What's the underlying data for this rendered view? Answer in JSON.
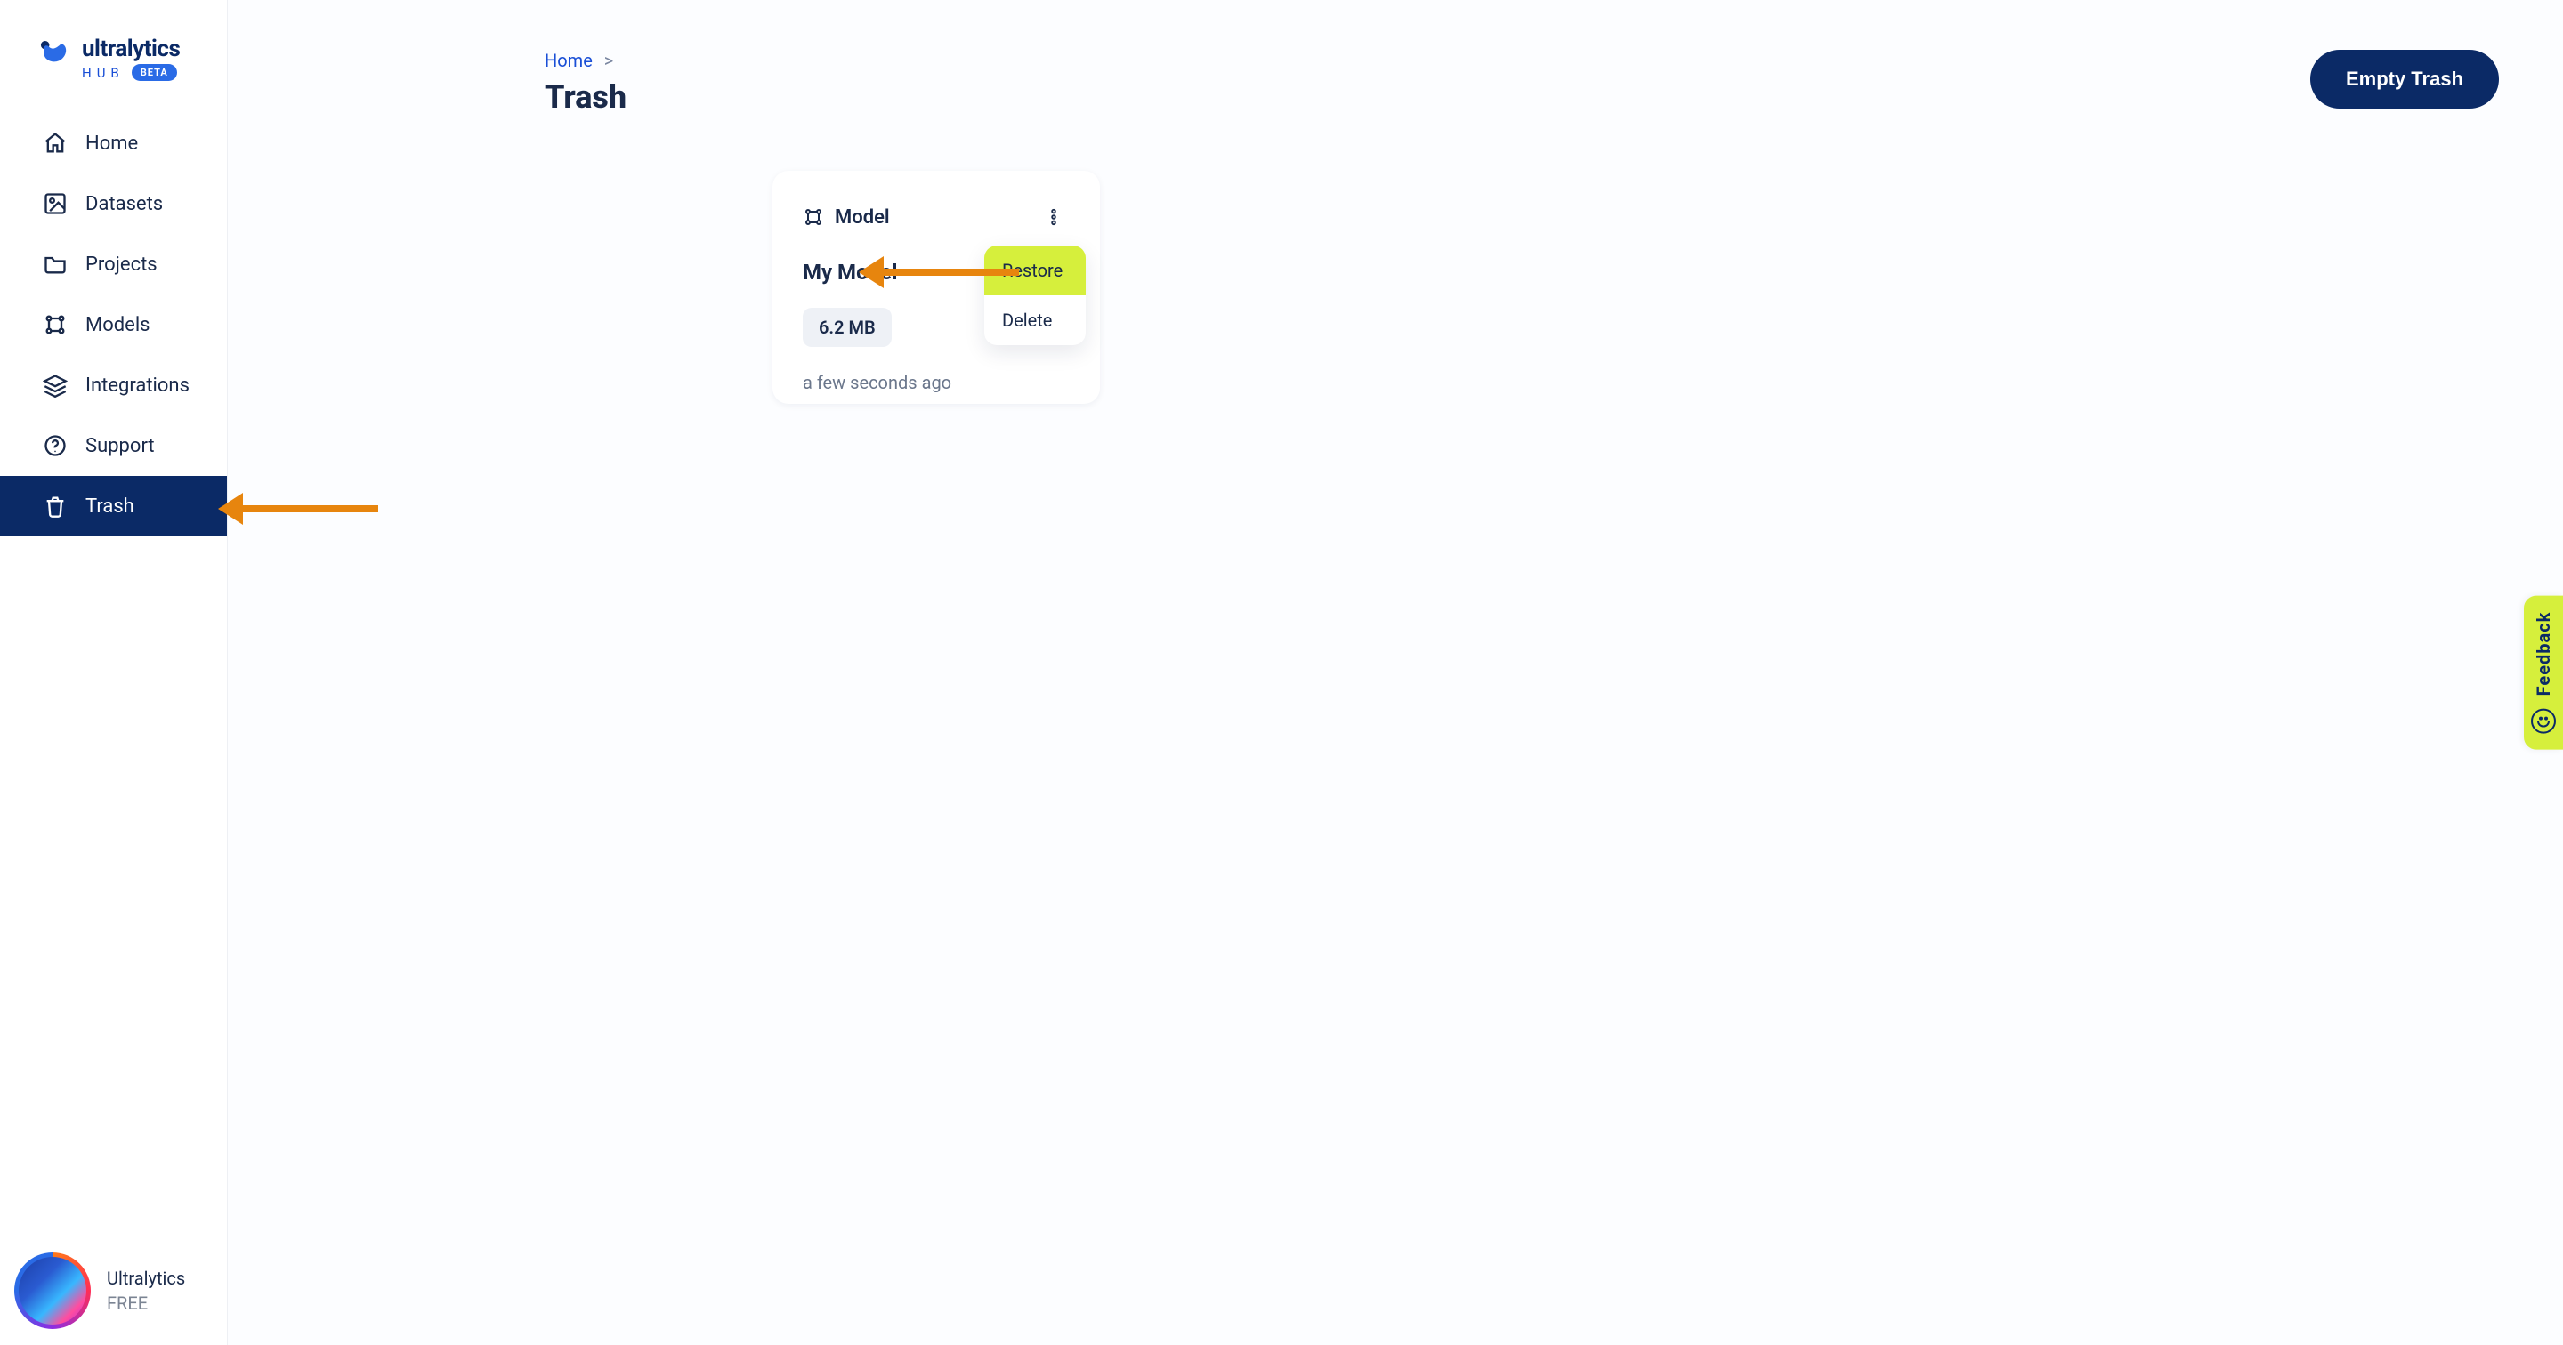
{
  "brand": {
    "name": "ultralytics",
    "hub_text": "HUB",
    "badge": "BETA"
  },
  "sidebar": {
    "items": [
      {
        "label": "Home",
        "icon": "home-icon",
        "active": false
      },
      {
        "label": "Datasets",
        "icon": "image-icon",
        "active": false
      },
      {
        "label": "Projects",
        "icon": "folder-icon",
        "active": false
      },
      {
        "label": "Models",
        "icon": "models-icon",
        "active": false
      },
      {
        "label": "Integrations",
        "icon": "layers-icon",
        "active": false
      },
      {
        "label": "Support",
        "icon": "help-icon",
        "active": false
      },
      {
        "label": "Trash",
        "icon": "trash-icon",
        "active": true
      }
    ]
  },
  "user": {
    "name": "Ultralytics",
    "plan": "FREE"
  },
  "breadcrumb": {
    "home": "Home",
    "sep": ">"
  },
  "page": {
    "title": "Trash"
  },
  "actions": {
    "empty_trash": "Empty Trash"
  },
  "card": {
    "type_label": "Model",
    "title": "My Model",
    "size_chip": "6.2 MB",
    "time": "a few seconds ago",
    "menu": {
      "restore": "Restore",
      "delete": "Delete"
    }
  },
  "feedback": {
    "label": "Feedback"
  },
  "colors": {
    "navy": "#0b2a66",
    "blue": "#1a4fd6",
    "lime": "#d6ef3c",
    "orange": "#e7850e"
  }
}
